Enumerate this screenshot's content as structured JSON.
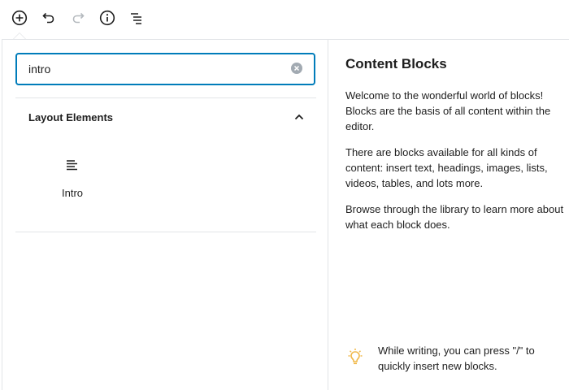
{
  "toolbar": {
    "buttons": [
      {
        "name": "add-block",
        "icon": "plus-circle-icon"
      },
      {
        "name": "undo",
        "icon": "undo-icon"
      },
      {
        "name": "redo",
        "icon": "redo-icon"
      },
      {
        "name": "info",
        "icon": "info-icon"
      },
      {
        "name": "block-navigation",
        "icon": "list-view-icon"
      }
    ]
  },
  "search": {
    "value": "intro",
    "clear_icon": "clear-icon"
  },
  "panel": {
    "title": "Layout Elements",
    "expanded": true,
    "blocks": [
      {
        "label": "Intro",
        "icon": "align-left-icon"
      }
    ]
  },
  "help": {
    "title": "Content Blocks",
    "paragraphs": [
      "Welcome to the wonderful world of blocks! Blocks are the basis of all content within the editor.",
      "There are blocks available for all kinds of content: insert text, headings, images, lists, videos, tables, and lots more.",
      "Browse through the library to learn more about what each block does."
    ],
    "tip": "While writing, you can press \"/\" to quickly insert new blocks.",
    "tip_icon": "lightbulb-icon"
  },
  "colors": {
    "accent": "#007cba",
    "border": "#e2e4e7",
    "tip": "#f0b849",
    "text": "#1e1e1e",
    "icon_muted": "#a2aab2"
  }
}
